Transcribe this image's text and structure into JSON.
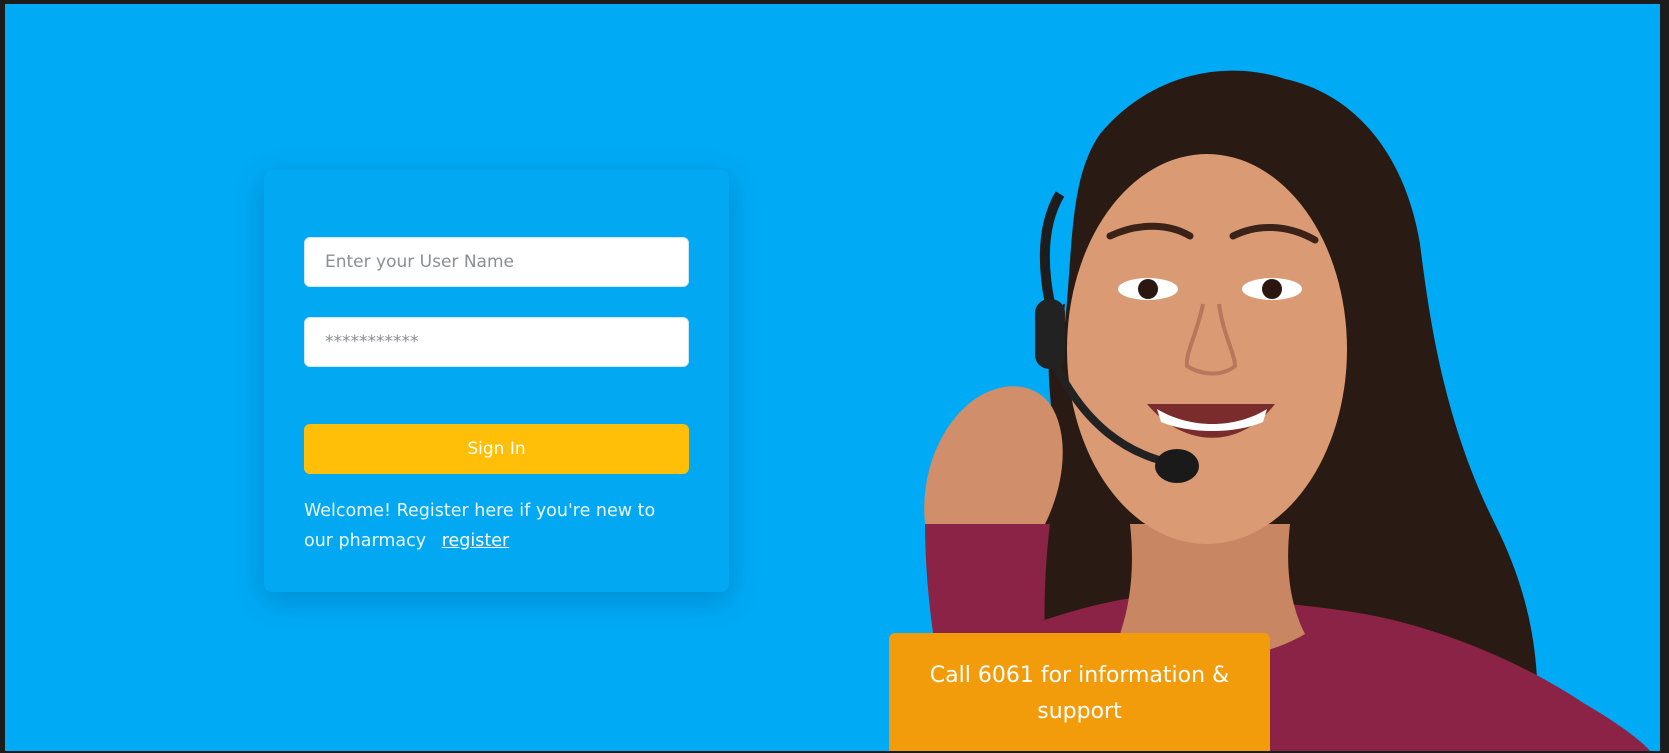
{
  "login": {
    "username_placeholder": "Enter your User Name",
    "password_placeholder": "***********",
    "signin_label": "Sign In",
    "welcome_text": "Welcome! Register here if you're new to our pharmacy",
    "register_link": "register"
  },
  "support": {
    "call_text": "Call 6061 for information & support"
  },
  "colors": {
    "background": "#00aaf5",
    "card": "#03a8f2",
    "signin_button": "#ffbf08",
    "call_banner": "#f39c0b"
  }
}
